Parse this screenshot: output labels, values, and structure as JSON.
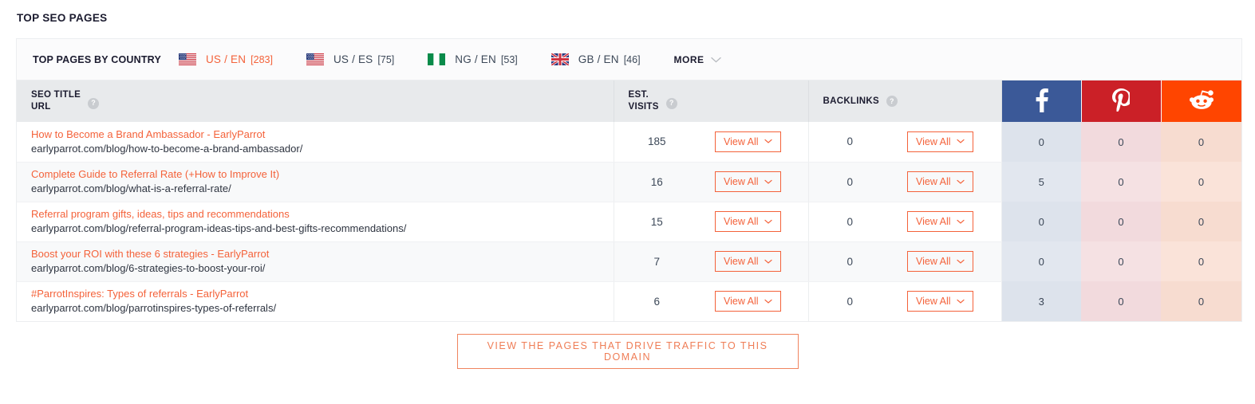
{
  "section": {
    "title": "TOP SEO PAGES"
  },
  "country_bar": {
    "label": "TOP PAGES BY COUNTRY",
    "more_label": "MORE",
    "tabs": [
      {
        "flag": "us-flag-icon",
        "name": "US / EN",
        "count": "[283]",
        "active": true
      },
      {
        "flag": "us-flag-icon",
        "name": "US / ES",
        "count": "[75]",
        "active": false
      },
      {
        "flag": "ng-flag-icon",
        "name": "NG / EN",
        "count": "[53]",
        "active": false
      },
      {
        "flag": "gb-flag-icon",
        "name": "GB / EN",
        "count": "[46]",
        "active": false
      }
    ]
  },
  "table": {
    "headers": {
      "seo_title_line1": "SEO TITLE",
      "seo_title_line2": "URL",
      "est_visits_line1": "EST.",
      "est_visits_line2": "VISITS",
      "backlinks": "BACKLINKS",
      "help_glyph": "?",
      "facebook": "facebook-icon",
      "pinterest": "pinterest-icon",
      "reddit": "reddit-icon"
    },
    "view_all_label": "View All",
    "rows": [
      {
        "title": "How to Become a Brand Ambassador - EarlyParrot",
        "url": "earlyparrot.com/blog/how-to-become-a-brand-ambassador/",
        "est_visits": "185",
        "backlinks": "0",
        "facebook": "0",
        "pinterest": "0",
        "reddit": "0"
      },
      {
        "title": "Complete Guide to Referral Rate (+How to Improve It)",
        "url": "earlyparrot.com/blog/what-is-a-referral-rate/",
        "est_visits": "16",
        "backlinks": "0",
        "facebook": "5",
        "pinterest": "0",
        "reddit": "0"
      },
      {
        "title": "Referral program gifts, ideas, tips and recommendations",
        "url": "earlyparrot.com/blog/referral-program-ideas-tips-and-best-gifts-recommendations/",
        "est_visits": "15",
        "backlinks": "0",
        "facebook": "0",
        "pinterest": "0",
        "reddit": "0"
      },
      {
        "title": "Boost your ROI with these 6 strategies - EarlyParrot",
        "url": "earlyparrot.com/blog/6-strategies-to-boost-your-roi/",
        "est_visits": "7",
        "backlinks": "0",
        "facebook": "0",
        "pinterest": "0",
        "reddit": "0"
      },
      {
        "title": "#ParrotInspires: Types of referrals - EarlyParrot",
        "url": "earlyparrot.com/blog/parrotinspires-types-of-referrals/",
        "est_visits": "6",
        "backlinks": "0",
        "facebook": "3",
        "pinterest": "0",
        "reddit": "0"
      }
    ]
  },
  "cta": {
    "label": "VIEW THE PAGES THAT DRIVE TRAFFIC TO THIS DOMAIN"
  },
  "colors": {
    "accent": "#f4623a",
    "facebook": "#3b5998",
    "pinterest": "#cb2027",
    "reddit": "#ff4500",
    "header_bg": "#e8eaec",
    "text": "#3c4858"
  }
}
